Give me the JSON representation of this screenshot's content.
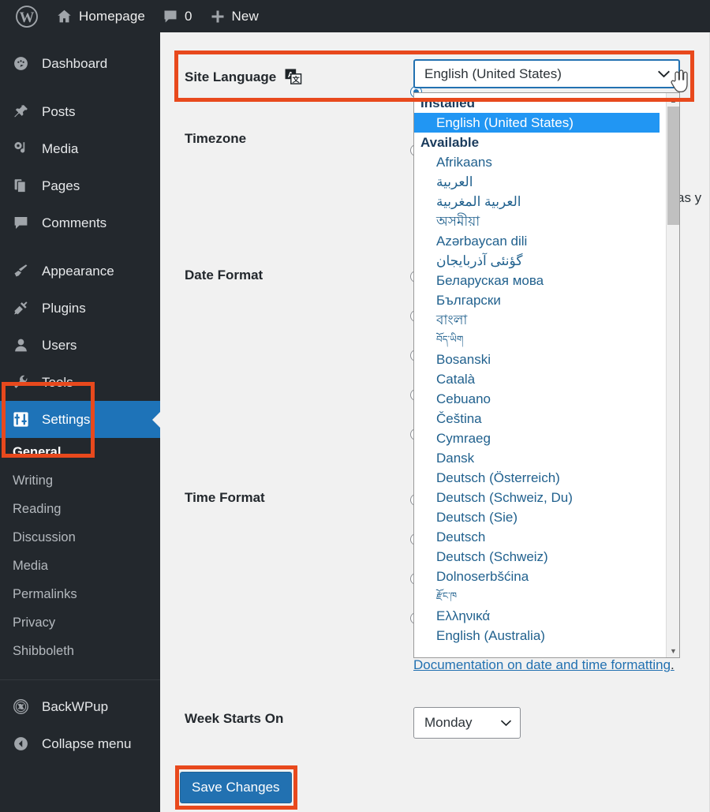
{
  "adminbar": {
    "wp_logo_icon": "wordpress-logo-icon",
    "items": [
      {
        "icon": "home-icon",
        "label": "Homepage"
      },
      {
        "icon": "comment-bubble-icon",
        "label": "0"
      },
      {
        "icon": "plus-icon",
        "label": "New"
      }
    ]
  },
  "sidebar": {
    "items": [
      {
        "label": "Dashboard",
        "icon": "dashboard-gauge-icon",
        "current": false
      },
      {
        "label": "Posts",
        "icon": "pin-icon",
        "current": false
      },
      {
        "label": "Media",
        "icon": "media-camera-music-icon",
        "current": false
      },
      {
        "label": "Pages",
        "icon": "pages-icon",
        "current": false
      },
      {
        "label": "Comments",
        "icon": "comment-bubble-icon",
        "current": false
      },
      {
        "label": "Appearance",
        "icon": "paintbrush-icon",
        "current": false
      },
      {
        "label": "Plugins",
        "icon": "plug-icon",
        "current": false
      },
      {
        "label": "Users",
        "icon": "user-icon",
        "current": false
      },
      {
        "label": "Tools",
        "icon": "wrench-icon",
        "current": false
      },
      {
        "label": "Settings",
        "icon": "settings-sliders-icon",
        "current": true
      }
    ],
    "settings_submenu": [
      {
        "label": "General",
        "current": true
      },
      {
        "label": "Writing",
        "current": false
      },
      {
        "label": "Reading",
        "current": false
      },
      {
        "label": "Discussion",
        "current": false
      },
      {
        "label": "Media",
        "current": false
      },
      {
        "label": "Permalinks",
        "current": false
      },
      {
        "label": "Privacy",
        "current": false
      },
      {
        "label": "Shibboleth",
        "current": false
      }
    ],
    "lower_items": [
      {
        "label": "BackWPup",
        "icon": "backwpup-icon"
      },
      {
        "label": "Collapse menu",
        "icon": "collapse-arrow-icon"
      }
    ]
  },
  "settings": {
    "site_language": {
      "label": "Site Language",
      "translation_icon": "translation-icon",
      "value": "English (United States)"
    },
    "timezone_label": "Timezone",
    "date_format_label": "Date Format",
    "time_format_label": "Time Format",
    "week_starts_on": {
      "label": "Week Starts On",
      "value": "Monday"
    },
    "doc_link_text": "Documentation on date and time formatting",
    "doc_link_suffix": ".",
    "partial_text_right": "as y",
    "save_button": "Save Changes"
  },
  "language_dropdown": {
    "groups": [
      {
        "label": "Installed",
        "options": [
          {
            "name": "English (United States)",
            "selected": true,
            "script": "latin"
          }
        ]
      },
      {
        "label": "Available",
        "options": [
          {
            "name": "Afrikaans",
            "selected": false,
            "script": "latin"
          },
          {
            "name": "العربية",
            "selected": false,
            "script": "arabic"
          },
          {
            "name": "العربية المغربية",
            "selected": false,
            "script": "arabic"
          },
          {
            "name": "অসমীয়া",
            "selected": false,
            "script": "bengali"
          },
          {
            "name": "Azərbaycan dili",
            "selected": false,
            "script": "latin"
          },
          {
            "name": "گؤنئی آذربایجان",
            "selected": false,
            "script": "arabic"
          },
          {
            "name": "Беларуская мова",
            "selected": false,
            "script": "cyrillic"
          },
          {
            "name": "Български",
            "selected": false,
            "script": "cyrillic"
          },
          {
            "name": "বাংলা",
            "selected": false,
            "script": "bengali"
          },
          {
            "name": "བོད་ཡིག",
            "selected": false,
            "script": "tibetan"
          },
          {
            "name": "Bosanski",
            "selected": false,
            "script": "latin"
          },
          {
            "name": "Català",
            "selected": false,
            "script": "latin"
          },
          {
            "name": "Cebuano",
            "selected": false,
            "script": "latin"
          },
          {
            "name": "Čeština",
            "selected": false,
            "script": "latin"
          },
          {
            "name": "Cymraeg",
            "selected": false,
            "script": "latin"
          },
          {
            "name": "Dansk",
            "selected": false,
            "script": "latin"
          },
          {
            "name": "Deutsch (Österreich)",
            "selected": false,
            "script": "latin"
          },
          {
            "name": "Deutsch (Schweiz, Du)",
            "selected": false,
            "script": "latin"
          },
          {
            "name": "Deutsch (Sie)",
            "selected": false,
            "script": "latin"
          },
          {
            "name": "Deutsch",
            "selected": false,
            "script": "latin"
          },
          {
            "name": "Deutsch (Schweiz)",
            "selected": false,
            "script": "latin"
          },
          {
            "name": "Dolnoserbšćina",
            "selected": false,
            "script": "latin"
          },
          {
            "name": "རྫོང་ཁ",
            "selected": false,
            "script": "tibetan"
          },
          {
            "name": "Ελληνικά",
            "selected": false,
            "script": "greek"
          },
          {
            "name": "English (Australia)",
            "selected": false,
            "script": "latin"
          }
        ]
      }
    ],
    "scrollbar": {
      "up_arrow": "▲",
      "down_arrow": "▼"
    }
  },
  "colors": {
    "highlight_orange": "#e8491d",
    "admin_dark": "#23282d",
    "current_menu_blue": "#1e73b8",
    "option_selected_blue": "#2196f3",
    "link_blue": "#2271b1",
    "button_blue": "#2271b1"
  },
  "cursor": {
    "type": "pointer-hand-cursor"
  }
}
